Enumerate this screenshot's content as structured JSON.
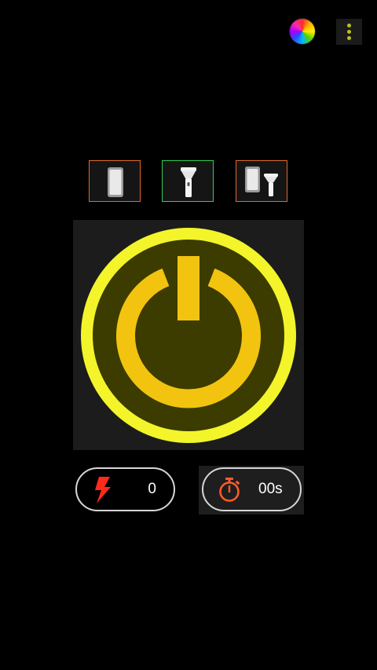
{
  "header": {
    "color_picker_icon": "color-wheel-icon",
    "menu_icon": "more-vert-icon"
  },
  "modes": [
    {
      "id": "screen",
      "icon": "phone-screen-icon",
      "border_color": "#e06a2c",
      "selected": false
    },
    {
      "id": "flash",
      "icon": "flashlight-icon",
      "border_color": "#2fcd53",
      "selected": true
    },
    {
      "id": "screen-and-flash",
      "icon": "phone-and-flashlight-icon",
      "border_color": "#e06a2c",
      "selected": false
    }
  ],
  "power": {
    "icon": "power-icon",
    "outer_ring_color": "#f3f52a",
    "inner_color": "#3c3c00",
    "symbol_color": "#f2c40f"
  },
  "counters": {
    "flash_count": "0",
    "timer_value": "00s",
    "flash_icon_color": "#ff2a1a",
    "timer_icon_color": "#ff5a2a"
  }
}
